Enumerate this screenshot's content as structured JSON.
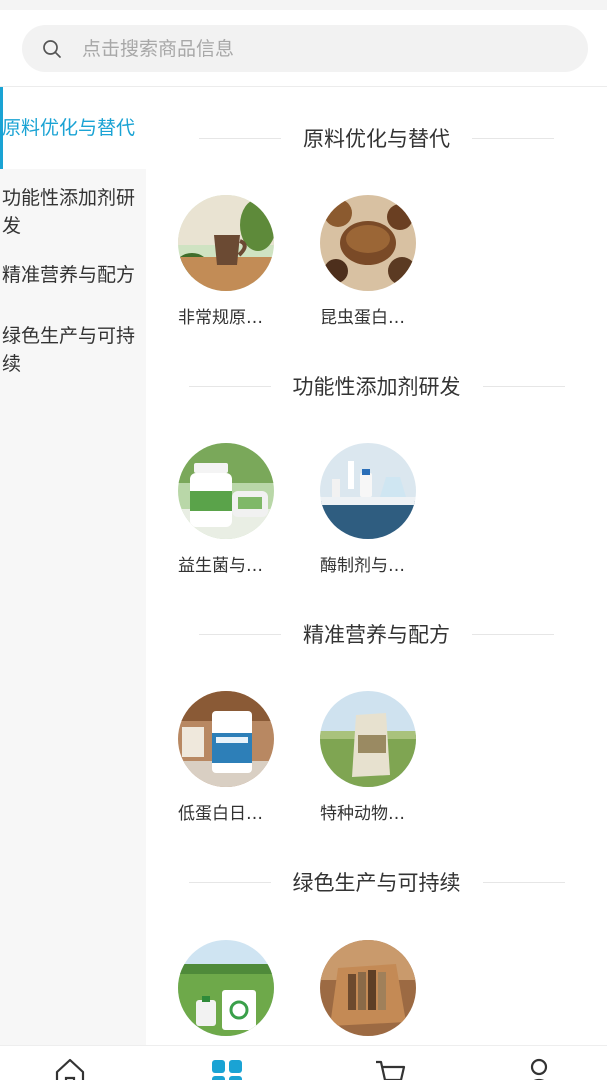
{
  "search": {
    "placeholder": "点击搜索商品信息"
  },
  "sidebar": {
    "items": [
      {
        "label": "原料优化与替代"
      },
      {
        "label": "功能性添加剂研发"
      },
      {
        "label": "精准营养与配方"
      },
      {
        "label": "绿色生产与可持续"
      }
    ],
    "active_index": 0,
    "accent_color": "#1aa3d4"
  },
  "sections": [
    {
      "title": "原料优化与替代",
      "items": [
        {
          "name": "非常规原…",
          "image": "wooden-cup-photo"
        },
        {
          "name": "昆虫蛋白…",
          "image": "insect-protein-pellets-photo"
        }
      ]
    },
    {
      "title": "功能性添加剂研发",
      "items": [
        {
          "name": "益生菌与…",
          "image": "probiotic-bottle-photo"
        },
        {
          "name": "酶制剂与…",
          "image": "laboratory-photo"
        }
      ]
    },
    {
      "title": "精准营养与配方",
      "items": [
        {
          "name": "低蛋白日…",
          "image": "feed-bag-kitchen-photo"
        },
        {
          "name": "特种动物…",
          "image": "feed-sack-field-photo"
        }
      ]
    },
    {
      "title": "绿色生产与可持续",
      "items": [
        {
          "name": "",
          "image": "recycling-field-photo"
        },
        {
          "name": "",
          "image": "cardboard-box-photo"
        }
      ]
    }
  ],
  "bottom_nav": [
    {
      "icon": "home-icon"
    },
    {
      "icon": "category-icon",
      "active": true
    },
    {
      "icon": "cart-icon"
    },
    {
      "icon": "user-icon"
    }
  ]
}
